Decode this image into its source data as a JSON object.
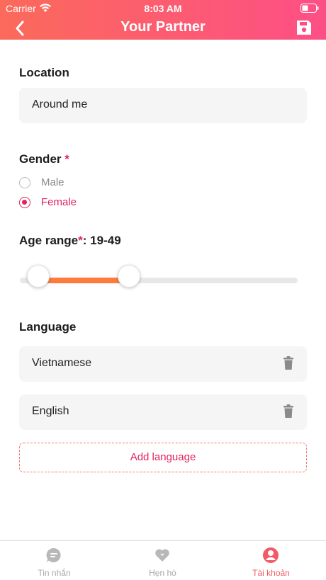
{
  "status_bar": {
    "carrier": "Carrier",
    "time": "8:03 AM"
  },
  "header": {
    "title": "Your Partner"
  },
  "location": {
    "label": "Location",
    "value": "Around me"
  },
  "gender": {
    "label": "Gender",
    "required_mark": "*",
    "options": [
      {
        "label": "Male",
        "selected": false
      },
      {
        "label": "Female",
        "selected": true
      }
    ]
  },
  "age_range": {
    "label": "Age range",
    "required_mark": "*",
    "separator": ":",
    "value": "19-49",
    "min": 19,
    "max": 49
  },
  "language": {
    "label": "Language",
    "items": [
      "Vietnamese",
      "English"
    ],
    "add_label": "Add language"
  },
  "tabbar": {
    "tabs": [
      {
        "label": "Tin nhắn",
        "icon": "chat-icon",
        "active": false
      },
      {
        "label": "Hẹn hò",
        "icon": "heart-icon",
        "active": false
      },
      {
        "label": "Tài khoản",
        "icon": "account-icon",
        "active": true
      }
    ]
  },
  "colors": {
    "accent": "#e0245e",
    "header_start": "#fb6a5a",
    "header_end": "#fd4f86",
    "slider_fill": "#ff7a3d",
    "active_tab": "#f25a66"
  }
}
